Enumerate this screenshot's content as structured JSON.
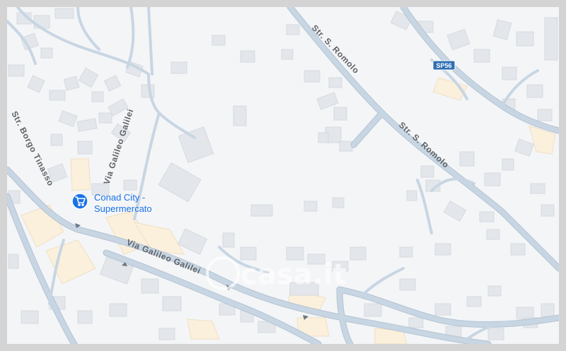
{
  "map": {
    "roads": {
      "borgo_tinasso": "Str. Borgo Tinasso",
      "galileo_vertical": "Via Galileo Galilei",
      "galileo_main": "Via Galileo Galilei",
      "romolo_upper": "Str. S. Romolo",
      "romolo_lower": "Str. S. Romolo"
    },
    "shield": {
      "label": "SP56",
      "color": "#2f6fb3"
    },
    "poi": {
      "name_line1": "Conad City -",
      "name_line2": "Supermercato",
      "icon": "shopping-cart-icon",
      "color": "#1a73e8"
    },
    "watermark": {
      "text": "casa.it"
    },
    "colors": {
      "background": "#f4f5f7",
      "road": "#c5d3e0",
      "road_edge": "#b3c3d3",
      "building": "#e3e6ea",
      "commercial": "#fbf0dc"
    }
  }
}
